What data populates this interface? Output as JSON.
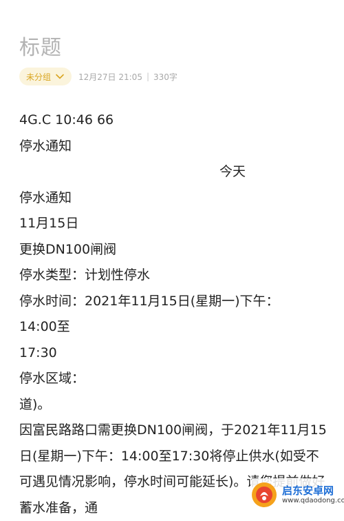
{
  "note": {
    "title": "标题",
    "group_label": "未分组",
    "date": "12月27日 21:05",
    "separator": "|",
    "word_count": "330字"
  },
  "content_lines": [
    "4G.C 10:46 66",
    "停水通知",
    "今天",
    "停水通知",
    "11月15日",
    "更换DN100闸阀",
    "停水类型：计划性停水",
    "停水时间：2021年11月15日(星期一)下午：",
    "14:00至",
    "17:30",
    "停水区域：",
    "道)。",
    "因富民路路口需更换DN100闸阀，于2021年11月15日(星期一)下午：14:00至17:30将停止供水(如受不可遇见情况影响，停水时间可能延长)。请您提前做好蓄水准备，通"
  ],
  "watermark": {
    "main": "启东安卓网",
    "sub": "www.qdaodong.com"
  },
  "colors": {
    "accent": "#d9a520",
    "chip_bg": "#fbf4dc",
    "title": "#b3b3b3",
    "meta": "#a8a8a8",
    "logo_orange": "#f5a21b",
    "logo_red": "#e8452f"
  },
  "icons": {
    "chevron": "chevron-down-icon",
    "logo": "qidong-logo-icon"
  }
}
